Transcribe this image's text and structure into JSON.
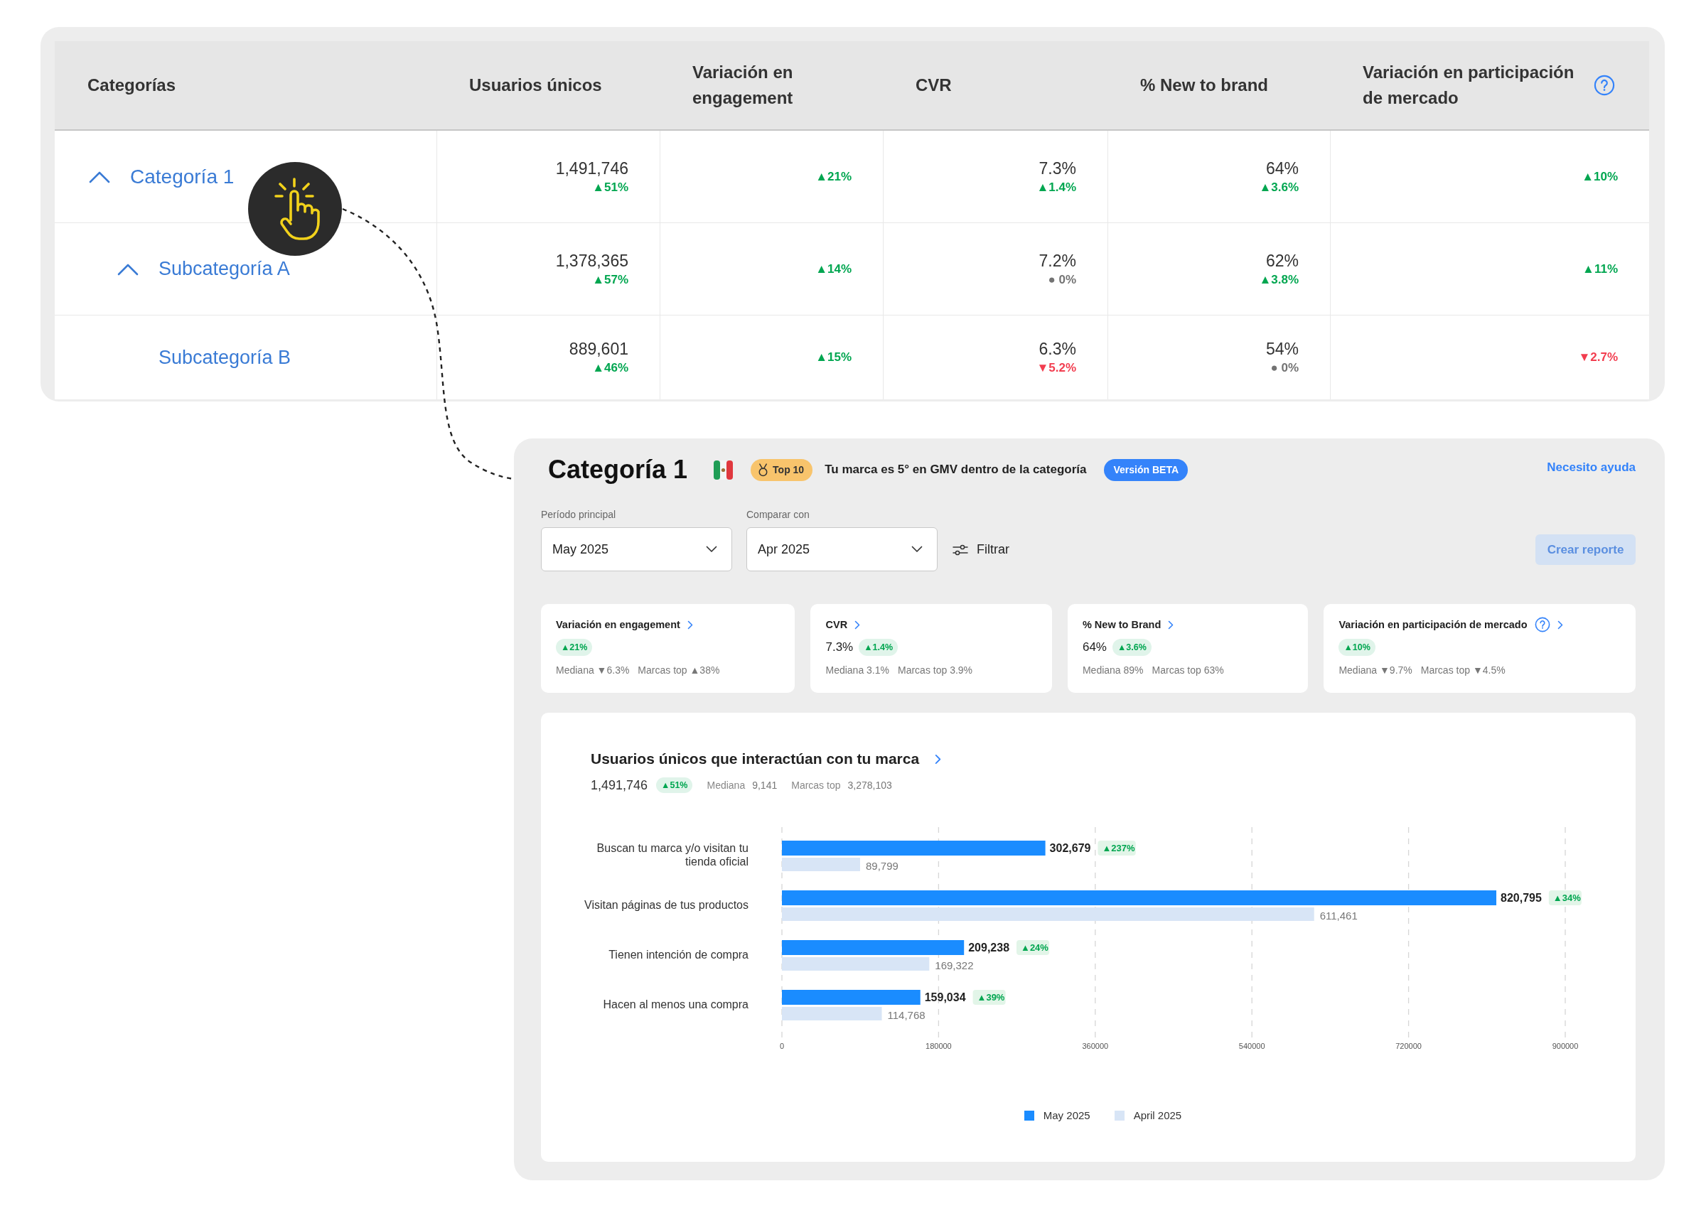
{
  "table": {
    "tree_column": {
      "label": "Categorías"
    },
    "columns": [
      {
        "label": "Usuarios únicos",
        "help": false
      },
      {
        "label": "Variación en engagement",
        "help": false
      },
      {
        "label": "CVR",
        "help": false
      },
      {
        "label": "% New to brand",
        "help": false
      },
      {
        "label": "Variación en participación de mercado",
        "help": true
      }
    ],
    "rows": [
      {
        "name": "Categoría 1",
        "kind": "group",
        "expanded": true,
        "cells": [
          {
            "value": "1,491,746",
            "delta": "▲51%",
            "color": "#00a650"
          },
          {
            "delta": "▲21%",
            "color": "#00a650"
          },
          {
            "value": "7.3%",
            "delta": "▲1.4%",
            "color": "#00a650"
          },
          {
            "value": "64%",
            "delta": "▲3.6%",
            "color": "#00a650"
          },
          {
            "delta": "▲10%",
            "color": "#00a650"
          }
        ],
        "children": [
          {
            "name": "Subcategoría A",
            "kind": "group",
            "expanded": true,
            "cells": [
              {
                "value": "1,378,365",
                "delta": "▲57%",
                "color": "#00a650"
              },
              {
                "delta": "▲14%",
                "color": "#00a650"
              },
              {
                "value": "7.2%",
                "delta": "● 0%",
                "color": "#737373"
              },
              {
                "value": "62%",
                "delta": "▲3.8%",
                "color": "#00a650"
              },
              {
                "delta": "▲11%",
                "color": "#00a650"
              }
            ]
          },
          {
            "name": "Subcategoría B",
            "kind": "item",
            "cells": [
              {
                "value": "889,601",
                "delta": "▲46%",
                "color": "#00a650"
              },
              {
                "delta": "▲15%",
                "color": "#00a650"
              },
              {
                "value": "6.3%",
                "delta": "▼5.2%",
                "color": "#f23d4f"
              },
              {
                "value": "54%",
                "delta": "● 0%",
                "color": "#737373"
              },
              {
                "delta": "▼2.7%",
                "color": "#f23d4f"
              }
            ]
          }
        ]
      }
    ]
  },
  "detail_panel": {
    "title": "Categoría 1",
    "badge": "Top 10",
    "ranking_text": "Tu marca es 5° en GMV dentro de la categoría",
    "beta_tag": "Versión BETA",
    "help_link": "Necesito ayuda",
    "filters": [
      {
        "label": "Período principal",
        "value": "May 2025"
      },
      {
        "label": "Comparar con",
        "value": "Apr 2025"
      }
    ],
    "filter_button": "Filtrar",
    "report_button": "Crear reporte",
    "metric_cards": [
      {
        "title": "Variación en engagement",
        "help": false,
        "delta": "▲21%",
        "color": "#00a650",
        "median": "Mediana ▼6.3%",
        "top": "Marcas top ▲38%"
      },
      {
        "title": "CVR",
        "help": false,
        "value": "7.3%",
        "delta": "▲1.4%",
        "color": "#00a650",
        "median": "Mediana 3.1%",
        "top": "Marcas top 3.9%"
      },
      {
        "title": "% New to Brand",
        "help": false,
        "value": "64%",
        "delta": "▲3.6%",
        "color": "#00a650",
        "median": "Mediana 89%",
        "top": "Marcas top 63%"
      },
      {
        "title": "Variación en participación de mercado",
        "help": true,
        "delta": "▲10%",
        "color": "#00a650",
        "median": "Mediana ▼9.7%",
        "top": "Marcas top ▼4.5%"
      }
    ],
    "chart_panel": {
      "total": "1,491,746",
      "delta": "▲51%",
      "color": "#00a650",
      "stats": [
        {
          "label": "Mediana",
          "value": "9,141"
        },
        {
          "label": "Marcas top",
          "value": "3,278,103"
        }
      ],
      "chart_data": {
        "type": "bar",
        "orientation": "horizontal",
        "title": "Usuarios únicos que interactúan con tu marca",
        "categories": [
          "Buscan tu marca y/o visitan tu tienda oficial",
          "Visitan páginas de tus productos",
          "Tienen intención de compra",
          "Hacen al menos una compra"
        ],
        "series": [
          {
            "name": "May 2025",
            "color": "#1a8cff",
            "values": [
              302679,
              820795,
              209238,
              159034
            ]
          },
          {
            "name": "April 2025",
            "color": "#d8e5f6",
            "values": [
              89799,
              611461,
              169322,
              114768
            ]
          }
        ],
        "xlim": [
          0,
          900000
        ],
        "xticks": [
          0,
          180000,
          360000,
          540000,
          720000,
          900000
        ],
        "grid": true,
        "value_labels": [
          [
            "302,679",
            "820,795",
            "209,238",
            "159,034"
          ],
          [
            "89,799",
            "611,461",
            "169,322",
            "114,768"
          ]
        ],
        "annotations": [
          {
            "text": "▲237%"
          },
          {
            "text": "▲34%"
          },
          {
            "text": "▲24%"
          },
          {
            "text": "▲39%"
          }
        ]
      }
    }
  }
}
